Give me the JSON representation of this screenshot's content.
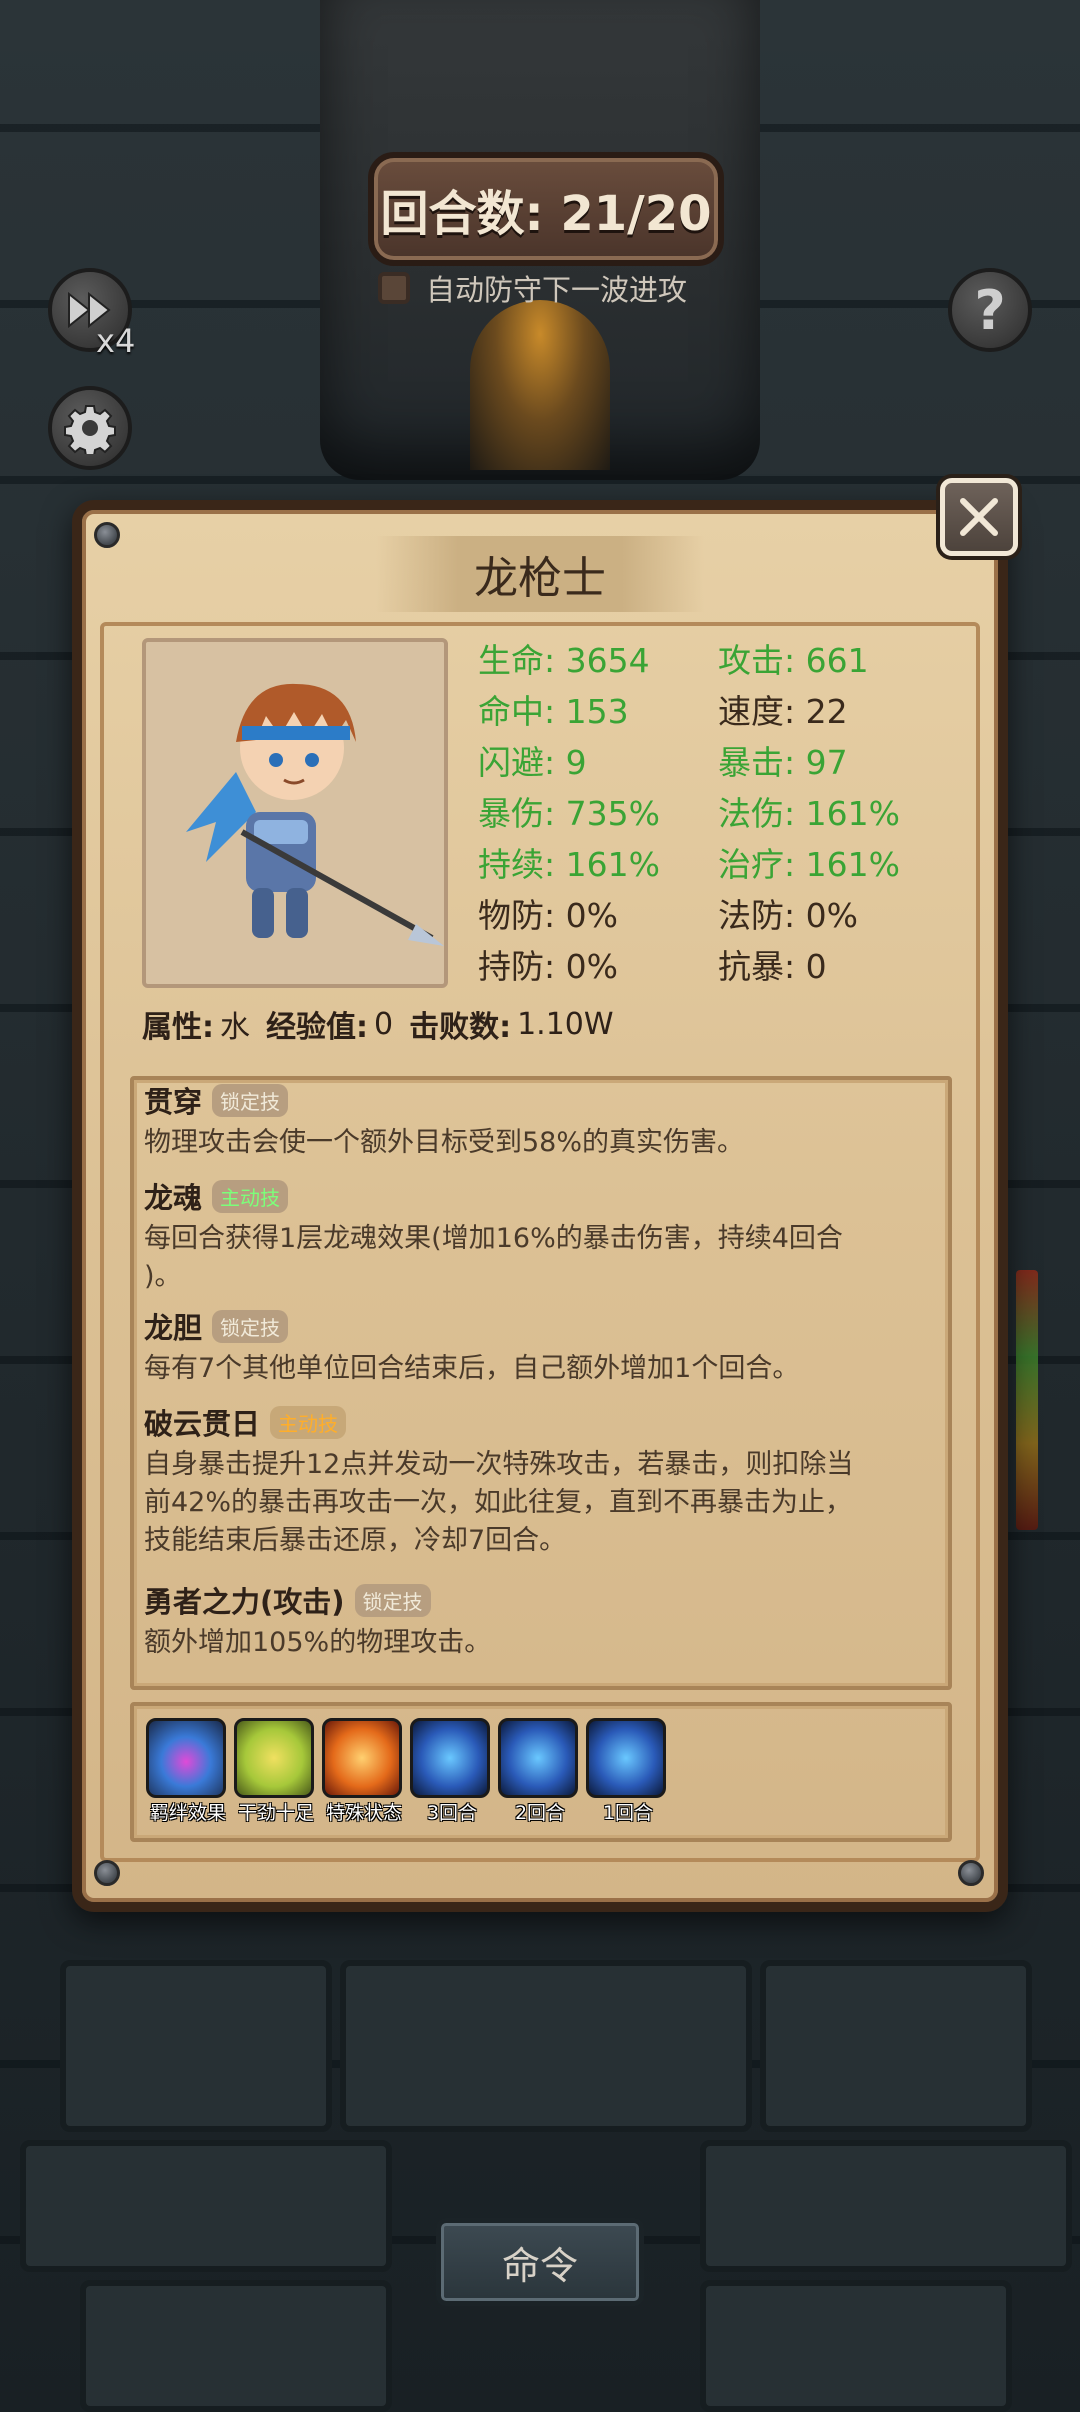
{
  "hud": {
    "round_label": "回合数: 21/20",
    "auto_defend_label": "自动防守下一波进攻",
    "auto_defend_checked": false,
    "speed_label": "x4",
    "help_label": "?"
  },
  "hero": {
    "name": "龙枪士",
    "stats": [
      {
        "label": "生命: 3654",
        "color": "green"
      },
      {
        "label": "攻击: 661",
        "color": "green"
      },
      {
        "label": "命中: 153",
        "color": "green"
      },
      {
        "label": "速度: 22",
        "color": "dark"
      },
      {
        "label": "闪避: 9",
        "color": "green"
      },
      {
        "label": "暴击: 97",
        "color": "green"
      },
      {
        "label": "暴伤: 735%",
        "color": "green"
      },
      {
        "label": "法伤: 161%",
        "color": "green"
      },
      {
        "label": "持续: 161%",
        "color": "green"
      },
      {
        "label": "治疗: 161%",
        "color": "green"
      },
      {
        "label": "物防: 0%",
        "color": "dark"
      },
      {
        "label": "法防: 0%",
        "color": "dark"
      },
      {
        "label": "持防: 0%",
        "color": "dark"
      },
      {
        "label": "抗暴: 0",
        "color": "dark"
      }
    ],
    "info": {
      "attr_label": "属性:",
      "attr_value": "水",
      "exp_label": "经验值:",
      "exp_value": "0",
      "kills_label": "击败数:",
      "kills_value": "1.10W"
    }
  },
  "skills": [
    {
      "name": "贯穿",
      "tag": "锁定技",
      "tag_style": "",
      "desc_lines": [
        "物理攻击会使一个额外目标受到58%的真实伤害。"
      ]
    },
    {
      "name": "龙魂",
      "tag": "主动技",
      "tag_style": "active-green",
      "desc_lines": [
        "每回合获得1层龙魂效果(增加16%的暴击伤害，持续4回合",
        ")。"
      ]
    },
    {
      "name": "龙胆",
      "tag": "锁定技",
      "tag_style": "",
      "desc_lines": [
        "每有7个其他单位回合结束后，自己额外增加1个回合。"
      ]
    },
    {
      "name": "破云贯日",
      "tag": "主动技",
      "tag_style": "active-orange",
      "desc_lines": [
        "自身暴击提升12点并发动一次特殊攻击，若暴击，则扣除当",
        "前42%的暴击再攻击一次，如此往复，直到不再暴击为止，",
        "技能结束后暴击还原，冷却7回合。"
      ]
    },
    {
      "name": "勇者之力(攻击)",
      "tag": "锁定技",
      "tag_style": "",
      "desc_lines": [
        "额外增加105%的物理攻击。"
      ]
    }
  ],
  "buffs": [
    {
      "label": "羁绊效果",
      "icon": "bond-icon"
    },
    {
      "label": "干劲十足",
      "icon": "energetic-icon"
    },
    {
      "label": "特殊状态",
      "icon": "special-state-icon"
    },
    {
      "label": "3回合",
      "icon": "demon-icon"
    },
    {
      "label": "2回合",
      "icon": "demon-icon"
    },
    {
      "label": "1回合",
      "icon": "demon-icon"
    }
  ],
  "command_label": "命令",
  "colors": {
    "green_stat": "#3aa435",
    "dark_text": "#3a2a1c",
    "panel_bg": "#dcc195"
  }
}
